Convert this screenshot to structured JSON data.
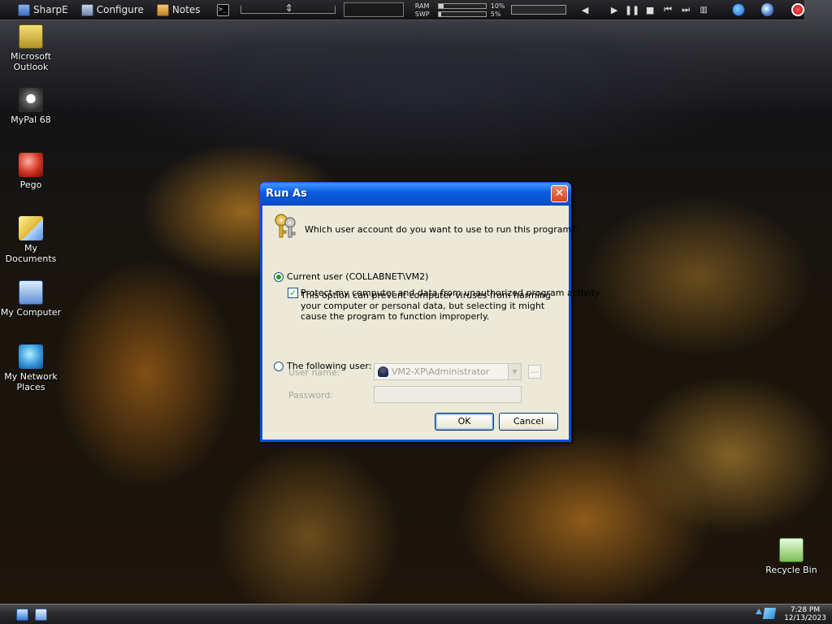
{
  "topbar": {
    "sharpe_label": "SharpE",
    "configure_label": "Configure",
    "notes_label": "Notes",
    "cmd_glyph": ">_",
    "ram_label": "RAM",
    "ram_pct_text": "10%",
    "ram_usage": 0.1,
    "swp_label": "SWP",
    "swp_pct_text": "5%",
    "swp_usage": 0.05,
    "media": {
      "play": "▶",
      "pause": "❚❚",
      "stop": "■",
      "prev": "⏮",
      "next": "⏭",
      "mute": "◀"
    }
  },
  "desktop_icons": [
    {
      "label": "Microsoft Outlook",
      "icon": "outlook-icon"
    },
    {
      "label": "MyPal 68",
      "icon": "mypal-icon"
    },
    {
      "label": "Pego",
      "icon": "pego-icon"
    },
    {
      "label": "My Documents",
      "icon": "my-documents-icon"
    },
    {
      "label": "My Computer",
      "icon": "my-computer-icon"
    },
    {
      "label": "My Network Places",
      "icon": "network-places-icon"
    },
    {
      "label": "Recycle Bin",
      "icon": "recycle-bin-icon"
    }
  ],
  "dialog": {
    "title": "Run As",
    "close_glyph": "✕",
    "question": "Which user account do you want to use to run this program?",
    "current_user_label": "Current user (COLLABNET\\VM2)",
    "current_user_selected": true,
    "protect_label": "Protect my computer and data from unauthorized program activity",
    "protect_checked": true,
    "protect_help": "This option can prevent computer viruses from harming your computer or personal data, but selecting it might cause the program to function improperly.",
    "following_user_label": "The following user:",
    "following_user_selected": false,
    "username_label": "User name:",
    "username_value": "VM2-XP\\Administrator",
    "browse_label": "...",
    "password_label": "Password:",
    "password_value": "",
    "ok_label": "OK",
    "cancel_label": "Cancel"
  },
  "taskbar": {
    "time": "7:28 PM",
    "date": "12/13/2023"
  },
  "colors": {
    "titlebar": "#0a5ae0",
    "dialog_bg": "#ece9d8",
    "close_button": "#d5421e",
    "radio_selected": "#21a121"
  }
}
